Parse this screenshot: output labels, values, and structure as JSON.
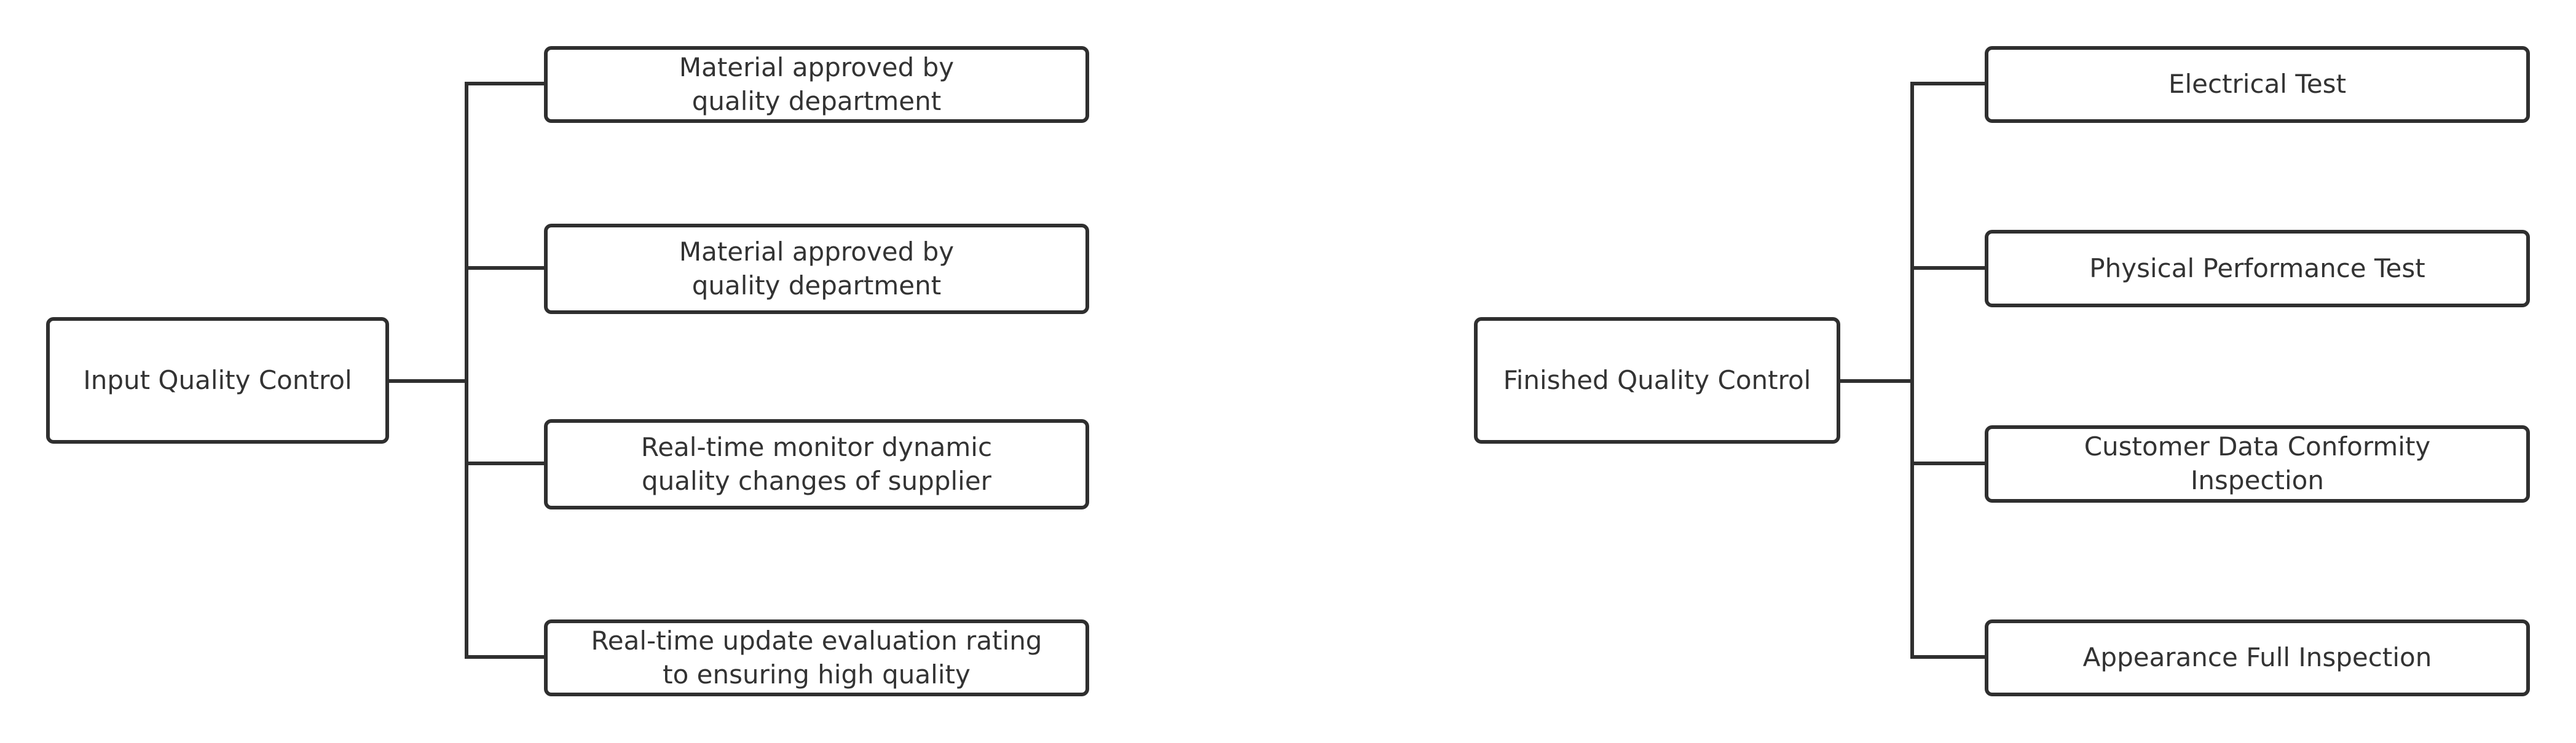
{
  "trees": [
    {
      "root": "Input Quality Control",
      "children": [
        "Material approved by\nquality department",
        "Material approved by\nquality department",
        "Real-time monitor dynamic\nquality changes of supplier",
        "Real-time update evaluation rating\nto ensuring high quality"
      ]
    },
    {
      "root": "Finished Quality Control",
      "children": [
        "Electrical Test",
        "Physical Performance Test",
        "Customer Data Conformity\nInspection",
        "Appearance Full Inspection"
      ]
    }
  ],
  "colors": {
    "stroke": "#2f2f2f",
    "text": "#333333",
    "background": "#ffffff"
  }
}
